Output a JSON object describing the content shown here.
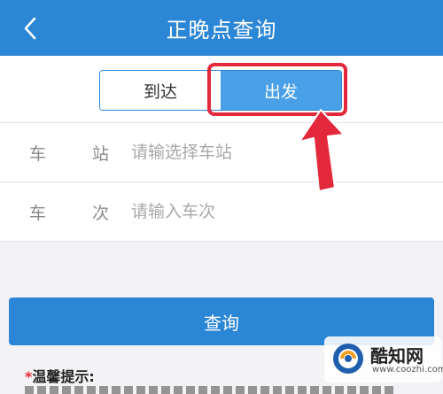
{
  "header": {
    "title": "正晚点查询",
    "back_icon": "chevron-left-icon"
  },
  "toggle": {
    "arrive_label": "到达",
    "depart_label": "出发",
    "selected": "出发"
  },
  "form": {
    "station": {
      "label_1": "车",
      "label_2": "站",
      "placeholder": "请输选择车站"
    },
    "train": {
      "label_1": "车",
      "label_2": "次",
      "placeholder": "请输入车次"
    }
  },
  "query_button": {
    "label": "查询"
  },
  "tips": {
    "star": "*",
    "title": "温馨提示:"
  },
  "watermark": {
    "name": "酷知网",
    "url": "www.coozhi.com"
  },
  "colors": {
    "primary": "#2b86d6",
    "segment_selected": "#4aa0e6",
    "highlight_red": "#e4283c",
    "background": "#f3f3f5"
  }
}
